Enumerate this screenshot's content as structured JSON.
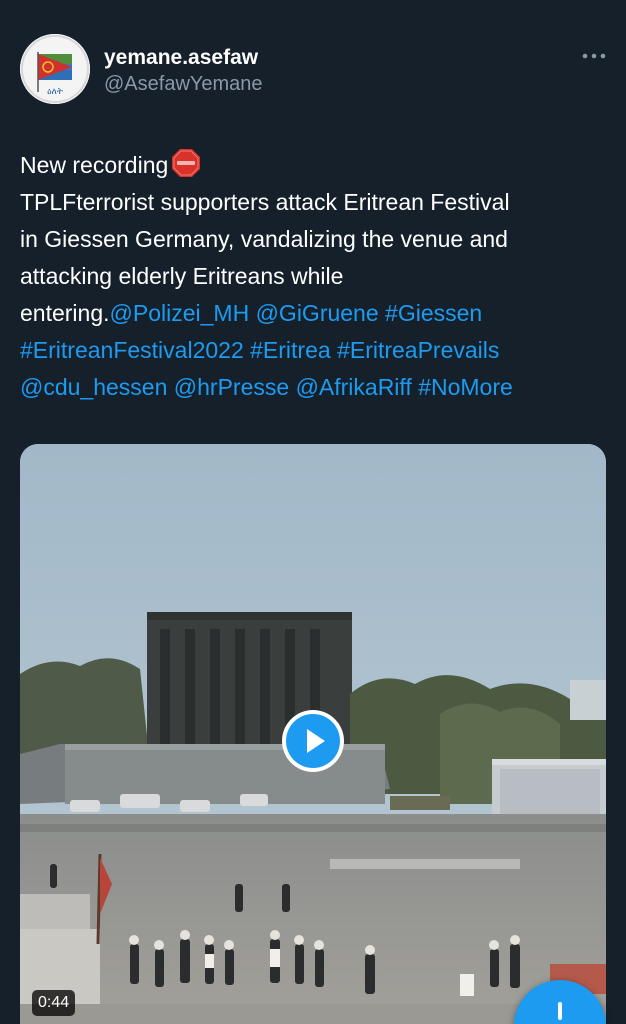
{
  "tweet": {
    "author": {
      "display_name": "yemane.asefaw",
      "handle": "@AsefawYemane",
      "avatar_text": "ዕለት"
    },
    "text": {
      "line1": "New recording",
      "line2": "TPLFterrorist supporters attack Eritrean Festival",
      "line3": "in Giessen  Germany, vandalizing the venue and",
      "line4": "attacking elderly Eritreans while",
      "line5_text": "entering.",
      "mentions": [
        "@Polizei_MH",
        "@GiGruene",
        "#Giessen",
        "#EritreanFestival2022",
        "#Eritrea",
        "#EritreaPrevails",
        "@cdu_hessen",
        "@hrPresse",
        "@AfrikaRiff",
        "#NoMore"
      ]
    },
    "media": {
      "duration": "0:44"
    }
  },
  "colors": {
    "background": "#15202b",
    "accent": "#1d9bf0",
    "secondary_text": "#8b98a5"
  },
  "icons": {
    "stop_emoji": "stop-sign-icon",
    "more": "more-horizontal-icon",
    "play": "play-icon",
    "compose": "plus-icon"
  }
}
